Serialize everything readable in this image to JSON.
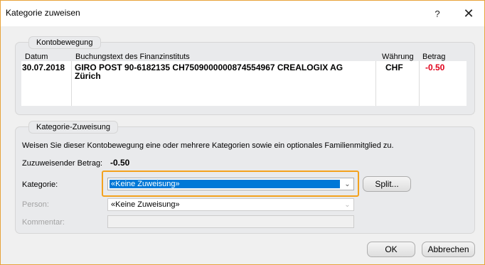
{
  "window": {
    "title": "Kategorie zuweisen",
    "help_label": "?",
    "close_label": "✕"
  },
  "kontobewegung": {
    "legend": "Kontobewegung",
    "col_datum": "Datum",
    "col_buchungstext": "Buchungstext des Finanzinstituts",
    "col_waehrung": "Währung",
    "col_betrag": "Betrag",
    "datum": "30.07.2018",
    "buchungstext_line1": "GIRO POST 90-6182135 CH7509000000874554967 CREALOGIX AG",
    "buchungstext_line2": "Zürich",
    "waehrung": "CHF",
    "betrag": "-0.50"
  },
  "zuweisung": {
    "legend": "Kategorie-Zuweisung",
    "description": "Weisen Sie dieser Kontobewegung eine oder mehrere Kategorien sowie ein optionales Familienmitglied zu.",
    "betrag_label": "Zuzuweisender Betrag:",
    "betrag_value": "-0.50",
    "kategorie_label": "Kategorie:",
    "kategorie_value": "«Keine Zuweisung»",
    "split_label": "Split...",
    "person_label": "Person:",
    "person_value": "«Keine Zuweisung»",
    "kommentar_label": "Kommentar:",
    "kommentar_value": ""
  },
  "buttons": {
    "ok": "OK",
    "cancel": "Abbrechen"
  },
  "colors": {
    "accent": "#f3a21e",
    "selection": "#0078d7",
    "negative": "#e0001b"
  }
}
